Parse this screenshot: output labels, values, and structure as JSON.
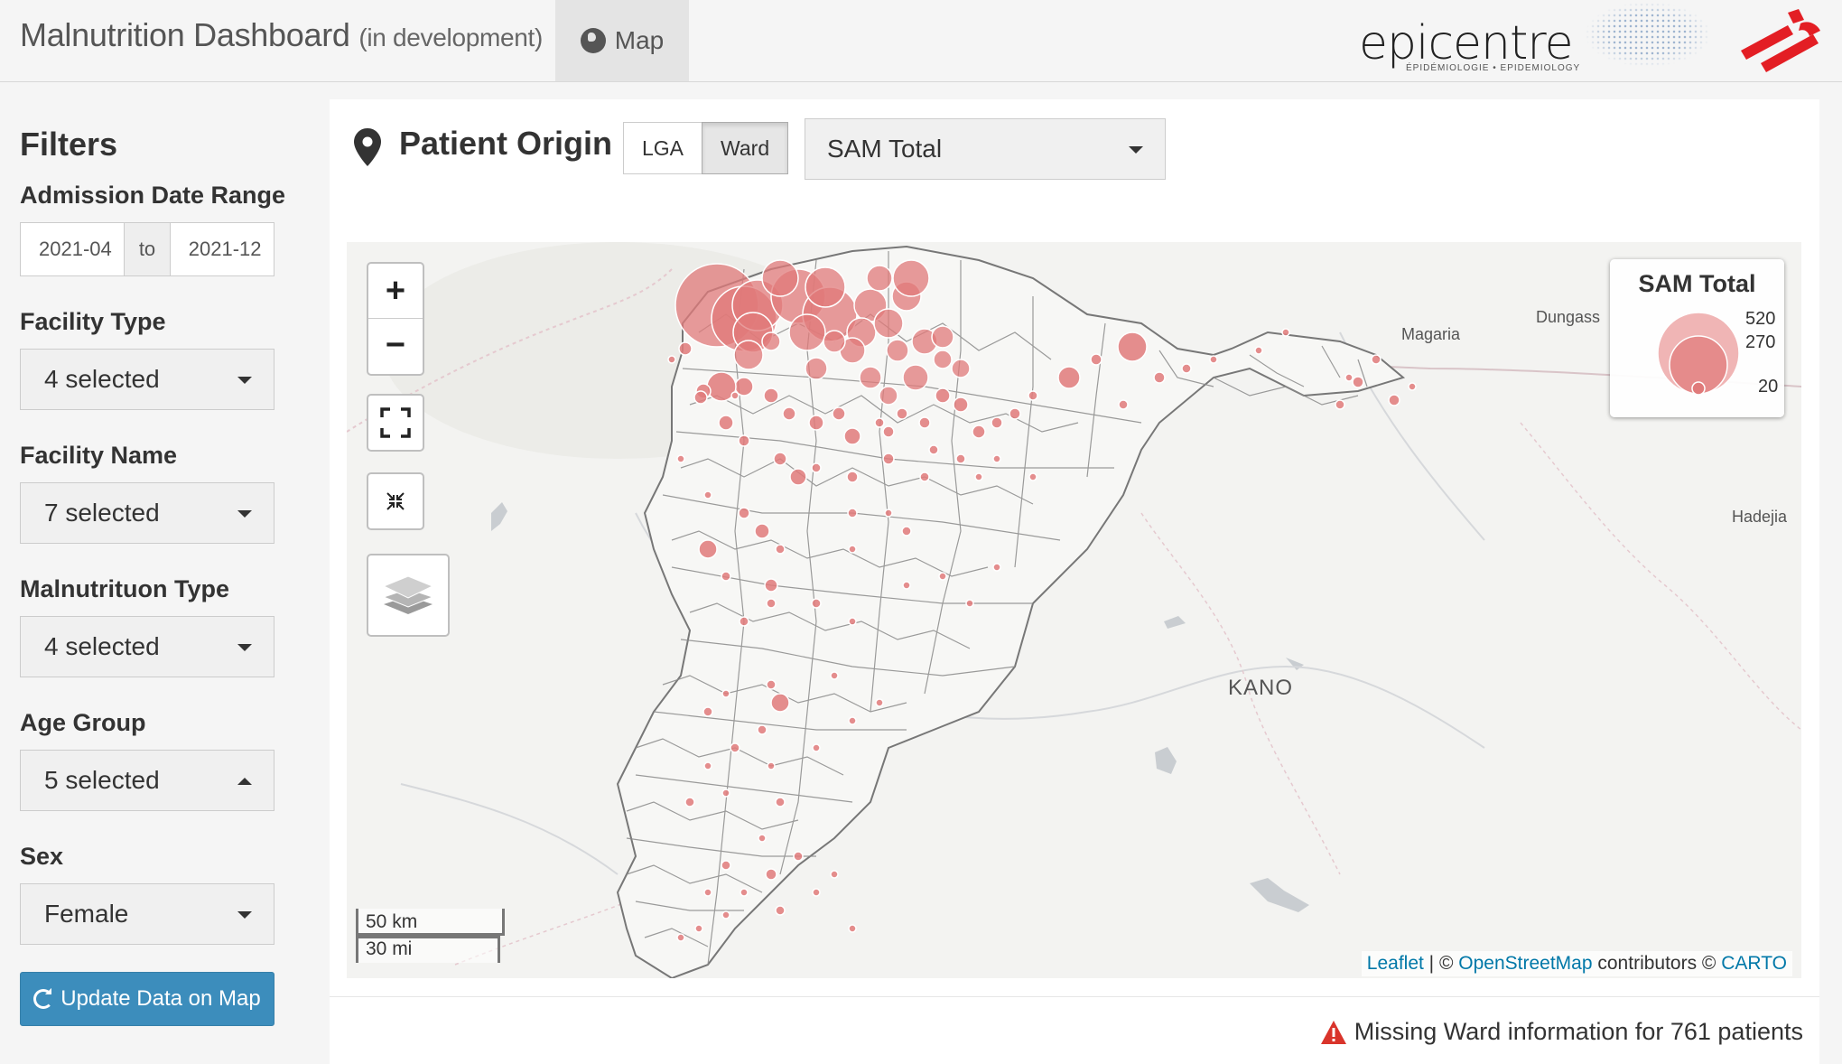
{
  "header": {
    "title": "Malnutrition Dashboard",
    "title_sub": "(in development)",
    "tab_map": "Map",
    "epicentre_word": "epicentre",
    "epicentre_tagline": "ÉPIDÉMIOLOGIE • EPIDEMIOLOGY"
  },
  "sidebar": {
    "title": "Filters",
    "date_label": "Admission Date Range",
    "date_start": "2021-04",
    "date_to": "to",
    "date_end": "2021-12",
    "facility_type_label": "Facility Type",
    "facility_type_value": "4 selected",
    "facility_name_label": "Facility Name",
    "facility_name_value": "7 selected",
    "malnutrition_type_label": "Malnutrituon Type",
    "malnutrition_type_value": "4 selected",
    "age_group_label": "Age Group",
    "age_group_value": "5 selected",
    "sex_label": "Sex",
    "sex_value": "Female",
    "update_button": "Update Data on Map"
  },
  "panel": {
    "title": "Patient Origin",
    "level_options": [
      "LGA",
      "Ward"
    ],
    "level_selected": "Ward",
    "metric_value": "SAM Total",
    "warning": "Missing Ward information for 761 patients"
  },
  "map": {
    "zoom_in": "+",
    "zoom_out": "−",
    "legend_title": "SAM Total",
    "legend_values": [
      "520",
      "270",
      "20"
    ],
    "places": [
      "Magaria",
      "Dungass",
      "Hadejia",
      "KANO"
    ],
    "scale_km": "50 km",
    "scale_mi": "30 mi",
    "attribution_leaflet": "Leaflet",
    "attribution_sep": " | © ",
    "attribution_osm": "OpenStreetMap",
    "attribution_mid": " contributors © ",
    "attribution_carto": "CARTO",
    "bubble_color": "#e07a7a",
    "icons": [
      "plus-icon",
      "minus-icon",
      "fullscreen-icon",
      "reset-view-icon",
      "layers-icon",
      "map-pin-icon",
      "globe-icon",
      "refresh-icon",
      "warning-icon"
    ]
  }
}
